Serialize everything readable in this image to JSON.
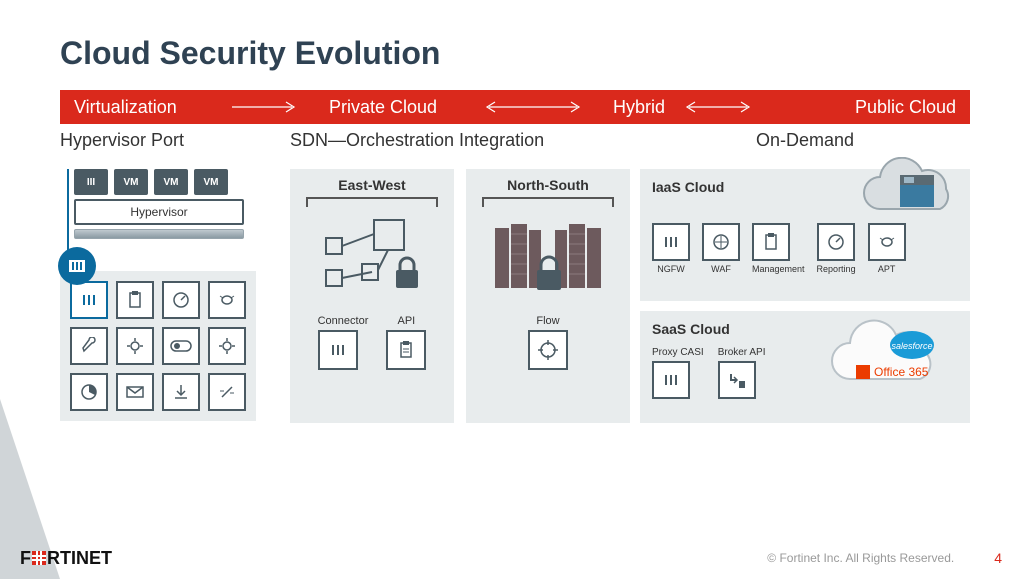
{
  "title": "Cloud Security Evolution",
  "band": {
    "seg1": "Virtualization",
    "seg2": "Private Cloud",
    "seg3": "Hybrid",
    "seg4": "Public Cloud"
  },
  "subcaptions": {
    "c1": "Hypervisor Port",
    "c2": "SDN—Orchestration Integration",
    "c3": "On-Demand"
  },
  "hypervisor": {
    "vm_tiles": [
      "III",
      "VM",
      "VM",
      "VM"
    ],
    "label": "Hypervisor",
    "feature_icons": [
      "bars",
      "clipboard",
      "gauge",
      "bug",
      "wrench",
      "gear",
      "toggle",
      "gear2",
      "pie",
      "mail",
      "download",
      "unlink"
    ]
  },
  "middle": {
    "east_west": {
      "title": "East-West",
      "controls": [
        {
          "label": "Connector",
          "icon": "bars"
        },
        {
          "label": "API",
          "icon": "clipboard"
        }
      ]
    },
    "north_south": {
      "title": "North-South",
      "controls": [
        {
          "label": "Flow",
          "icon": "target"
        }
      ]
    }
  },
  "right": {
    "iaas": {
      "title": "IaaS Cloud",
      "items": [
        {
          "label": "NGFW",
          "icon": "bars"
        },
        {
          "label": "WAF",
          "icon": "shield"
        },
        {
          "label": "Management",
          "icon": "clipboard"
        },
        {
          "label": "Reporting",
          "icon": "gauge"
        },
        {
          "label": "APT",
          "icon": "bug"
        }
      ]
    },
    "saas": {
      "title": "SaaS Cloud",
      "items": [
        {
          "label": "Proxy CASI",
          "icon": "bars"
        },
        {
          "label": "Broker API",
          "icon": "arrow-db"
        }
      ],
      "office_label": "Office 365",
      "salesforce_label": "salesforce"
    }
  },
  "footer": {
    "brand": "FORTINET",
    "copyright": "© Fortinet Inc. All Rights Reserved.",
    "page": "4"
  }
}
